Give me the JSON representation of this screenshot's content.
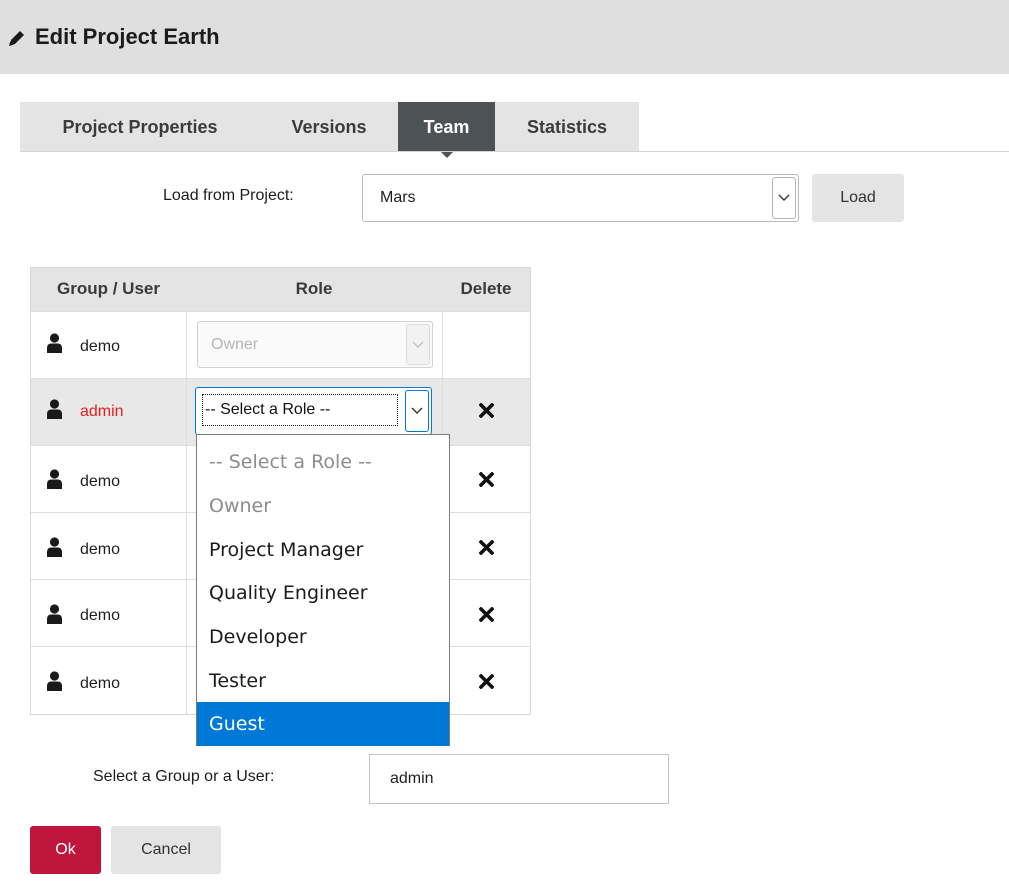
{
  "header": {
    "title": "Edit Project Earth",
    "icon": "pencil-icon"
  },
  "tabs": [
    {
      "label": "Project Properties",
      "active": false
    },
    {
      "label": "Versions",
      "active": false
    },
    {
      "label": "Team",
      "active": true
    },
    {
      "label": "Statistics",
      "active": false
    }
  ],
  "load_from": {
    "label": "Load from Project:",
    "selected": "Mars",
    "button_label": "Load"
  },
  "table": {
    "headers": [
      "Group / User",
      "Role",
      "Delete"
    ],
    "rows": [
      {
        "name": "demo",
        "role": "Owner",
        "role_disabled": true,
        "deletable": false,
        "selected": false
      },
      {
        "name": "admin",
        "role": "-- Select a Role --",
        "role_disabled": false,
        "deletable": true,
        "selected": true,
        "name_color": "#e0201f"
      },
      {
        "name": "demo",
        "deletable": true,
        "selected": false
      },
      {
        "name": "demo",
        "deletable": true,
        "selected": false
      },
      {
        "name": "demo",
        "deletable": true,
        "selected": false
      },
      {
        "name": "demo",
        "deletable": true,
        "selected": false
      }
    ]
  },
  "role_dropdown": {
    "options": [
      "-- Select a Role --",
      "Owner",
      "Project Manager",
      "Quality Engineer",
      "Developer",
      "Tester",
      "Guest"
    ],
    "highlighted": "Guest",
    "highlight_color": "#0078d7"
  },
  "add_member": {
    "label": "Select a Group or a User:",
    "value": "admin"
  },
  "actions": {
    "ok_label": "Ok",
    "cancel_label": "Cancel",
    "ok_color": "#c0163d"
  }
}
